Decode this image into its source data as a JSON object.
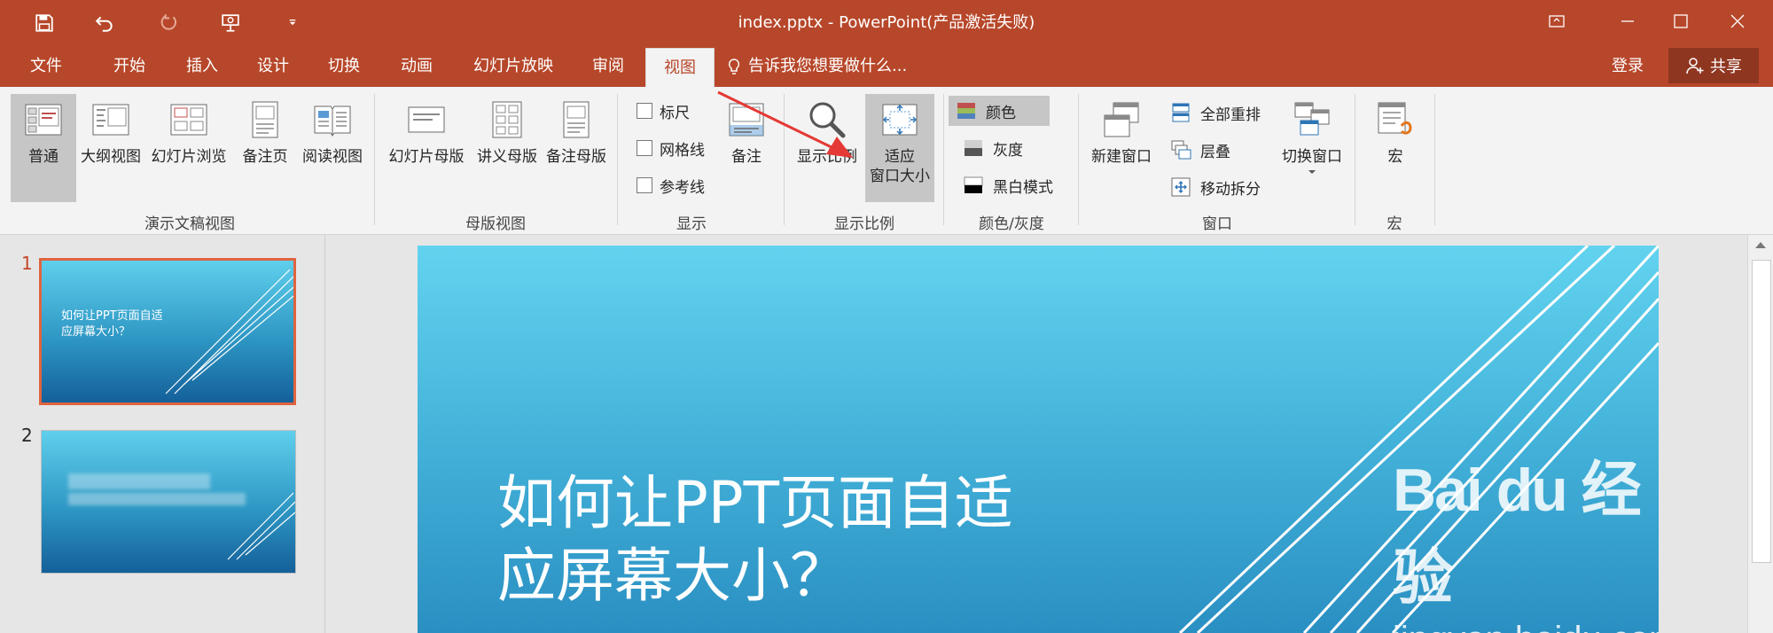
{
  "window": {
    "title": "index.pptx - PowerPoint(产品激活失败)"
  },
  "tabs": [
    "文件",
    "开始",
    "插入",
    "设计",
    "切换",
    "动画",
    "幻灯片放映",
    "审阅",
    "视图"
  ],
  "active_tab": "视图",
  "tell_me": "告诉我您想要做什么...",
  "account": {
    "login": "登录",
    "share": "共享"
  },
  "ribbon": {
    "presentation_views": {
      "label": "演示文稿视图",
      "buttons": [
        "普通",
        "大纲视图",
        "幻灯片浏览",
        "备注页",
        "阅读视图"
      ]
    },
    "master_views": {
      "label": "母版视图",
      "buttons": [
        "幻灯片母版",
        "讲义母版",
        "备注母版"
      ]
    },
    "show": {
      "label": "显示",
      "checkboxes": [
        "标尺",
        "网格线",
        "参考线"
      ],
      "notes": "备注"
    },
    "zoom": {
      "label": "显示比例",
      "zoom_button": "显示比例",
      "fit_button_line1": "适应",
      "fit_button_line2": "窗口大小"
    },
    "color": {
      "label": "颜色/灰度",
      "items": [
        "颜色",
        "灰度",
        "黑白模式"
      ]
    },
    "window": {
      "label": "窗口",
      "new_window": "新建窗口",
      "items": [
        "全部重排",
        "层叠",
        "移动拆分"
      ],
      "switch": "切换窗口"
    },
    "macros": {
      "label": "宏",
      "button": "宏"
    }
  },
  "slides": [
    {
      "number": "1",
      "title": "如何让PPT页面自适\n应屏幕大小？"
    },
    {
      "number": "2"
    }
  ],
  "main_slide": {
    "title": "如何让PPT页面自适\n应屏幕大小？"
  },
  "watermark": {
    "logo": "Bai du 经验",
    "url": "jingyan.baidu.com"
  },
  "colors": {
    "accent": "#b7472a",
    "arrow": "#e53935"
  }
}
